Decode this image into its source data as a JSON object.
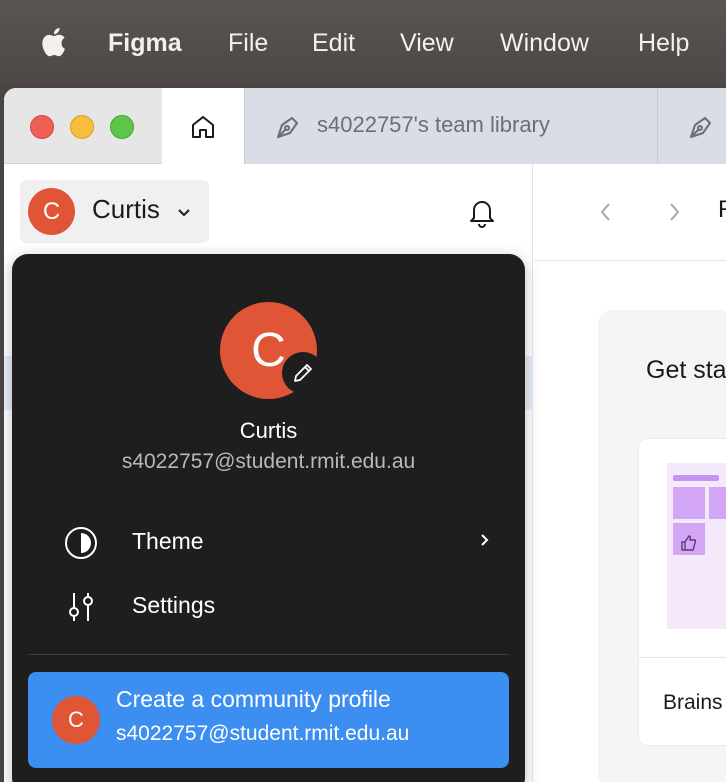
{
  "menubar": {
    "app": "Figma",
    "items": [
      "File",
      "Edit",
      "View",
      "Window",
      "Help"
    ]
  },
  "tabs": {
    "library": "s4022757's team library"
  },
  "user": {
    "initial": "C",
    "name": "Curtis",
    "email": "s4022757@student.rmit.edu.au"
  },
  "dropdown": {
    "items": [
      {
        "label": "Theme"
      },
      {
        "label": "Settings"
      }
    ],
    "community": {
      "title": "Create a community profile",
      "email": "s4022757@student.rmit.edu.au"
    }
  },
  "main": {
    "title": "R",
    "get_started": "Get sta",
    "card_label": "Brains"
  },
  "colors": {
    "avatar": "#e05535",
    "community": "#3c8ff0",
    "dropdown_bg": "#1e1e1e"
  }
}
